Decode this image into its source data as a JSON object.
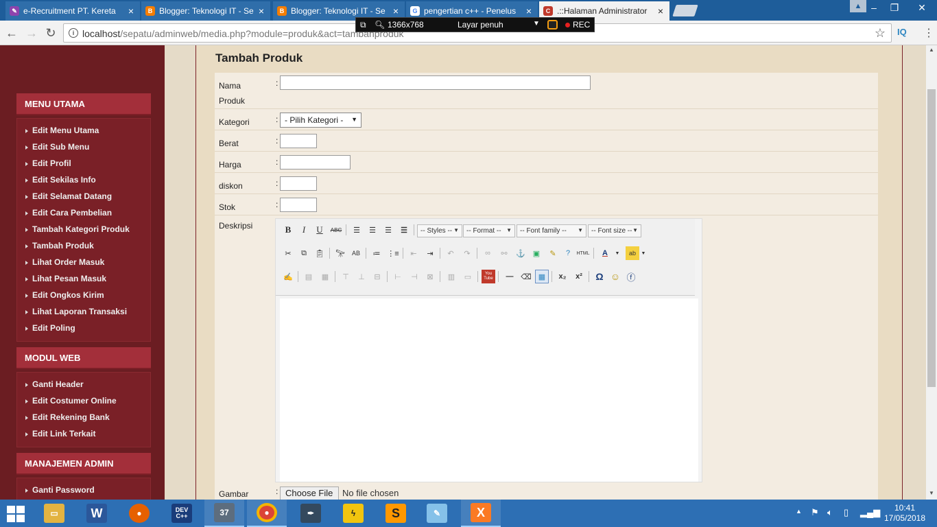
{
  "browser": {
    "tabs": [
      {
        "title": "e-Recruitment PT. Kereta",
        "favicon": "pencil-icon",
        "favicon_color": "#8e44ad"
      },
      {
        "title": "Blogger: Teknologi IT - Se",
        "favicon": "blogger-icon",
        "favicon_color": "#f57d00"
      },
      {
        "title": "Blogger: Teknologi IT - Se",
        "favicon": "blogger-icon",
        "favicon_color": "#f57d00"
      },
      {
        "title": "pengertian c++ - Penelus",
        "favicon": "google-icon",
        "favicon_color": "#4285f4"
      },
      {
        "title": ".::Halaman Administrator",
        "favicon": "admin-icon",
        "favicon_color": "#c0392b",
        "active": true
      }
    ],
    "url_host": "localhost",
    "url_path": "/sepatu/adminweb/media.php?module=produk&act=tambahproduk",
    "extension_label": "IQ"
  },
  "recorder": {
    "resolution": "1366x768",
    "mode": "Layar penuh",
    "rec_label": "REC"
  },
  "sidebar": {
    "sections": [
      {
        "title": "MENU UTAMA",
        "items": [
          "Edit Menu Utama",
          "Edit Sub Menu",
          "Edit Profil",
          "Edit Sekilas Info",
          "Edit Selamat Datang",
          "Edit Cara Pembelian",
          "Tambah Kategori Produk",
          "Tambah Produk",
          "Lihat Order Masuk",
          "Lihat Pesan Masuk",
          "Edit Ongkos Kirim",
          "Lihat Laporan Transaksi",
          "Edit Poling"
        ]
      },
      {
        "title": "MODUL WEB",
        "items": [
          "Ganti Header",
          "Edit Costumer Online",
          "Edit Rekening Bank",
          "Edit Link Terkait"
        ]
      },
      {
        "title": "MANAJEMEN ADMIN",
        "items": [
          "Ganti Password"
        ]
      }
    ]
  },
  "form": {
    "title": "Tambah Produk",
    "colon": ":",
    "fields": {
      "nama_label_1": "Nama",
      "nama_label_2": "Produk",
      "nama_value": "",
      "kategori_label": "Kategori",
      "kategori_selected": "- Pilih Kategori -",
      "berat_label": "Berat",
      "berat_value": "",
      "harga_label": "Harga",
      "harga_value": "",
      "diskon_label": "diskon",
      "diskon_value": "",
      "stok_label": "Stok",
      "stok_value": "",
      "deskripsi_label": "Deskripsi",
      "gambar_label": "Gambar",
      "choose_file": "Choose File",
      "no_file": "No file chosen"
    },
    "editor": {
      "styles": "-- Styles --",
      "format": "-- Format --",
      "font_family": "-- Font family --",
      "font_size": "-- Font size --",
      "html_label": "HTML",
      "youtube_label": "You Tube"
    }
  },
  "taskbar": {
    "apps": [
      {
        "name": "file-explorer-icon",
        "color": "#e3b341",
        "label": ""
      },
      {
        "name": "word-icon",
        "color": "#2b579a",
        "label": "W"
      },
      {
        "name": "firefox-icon",
        "color": "#e66000",
        "label": ""
      },
      {
        "name": "devcpp-icon",
        "color": "#1a3c7a",
        "label": "DEV C++"
      },
      {
        "name": "calendar-icon",
        "color": "#5d6d7e",
        "label": "37"
      },
      {
        "name": "chrome-icon",
        "color": "#db4437",
        "label": ""
      },
      {
        "name": "pen-tool-icon",
        "color": "#34495e",
        "label": ""
      },
      {
        "name": "flash-icon",
        "color": "#f1c40f",
        "label": ""
      },
      {
        "name": "sublime-icon",
        "color": "#ff9800",
        "label": "S"
      },
      {
        "name": "notepad-icon",
        "color": "#85c1e9",
        "label": ""
      },
      {
        "name": "xampp-icon",
        "color": "#fb7a24",
        "label": "X"
      }
    ],
    "time": "10:41",
    "date": "17/05/2018"
  }
}
